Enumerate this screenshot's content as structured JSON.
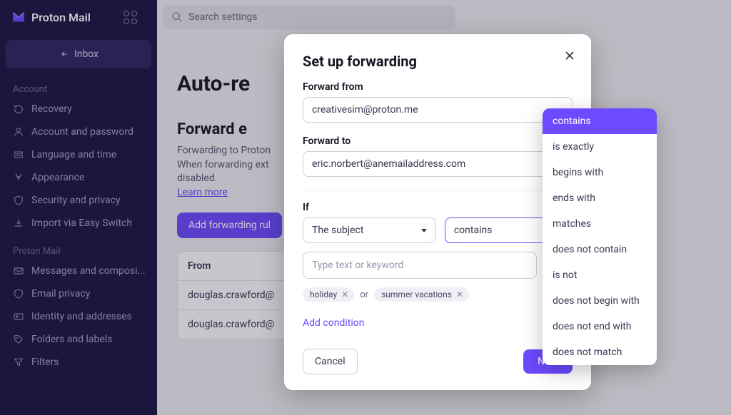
{
  "brand": "Proton Mail",
  "search": {
    "placeholder": "Search settings"
  },
  "inbox_label": "Inbox",
  "sections": {
    "account": {
      "title": "Account",
      "items": [
        "Recovery",
        "Account and password",
        "Language and time",
        "Appearance",
        "Security and privacy",
        "Import via Easy Switch"
      ]
    },
    "proton_mail": {
      "title": "Proton Mail",
      "items": [
        "Messages and composi...",
        "Email privacy",
        "Identity and addresses",
        "Folders and labels",
        "Filters"
      ]
    }
  },
  "page": {
    "h1": "Auto-re",
    "h2": "Forward e",
    "para1": "Forwarding to Proton",
    "para2": "When forwarding ext",
    "para3": "disabled.",
    "learn_more": "Learn more",
    "add_rule_btn": "Add forwarding rul",
    "table": {
      "header": "From",
      "rows": [
        "douglas.crawford@",
        "douglas.crawford@"
      ]
    }
  },
  "modal": {
    "title": "Set up forwarding",
    "from_label": "Forward from",
    "from_value": "creativesim@proton.me",
    "to_label": "Forward to",
    "to_value": "eric.norbert@anemailaddress.com",
    "if_label": "If",
    "subject_select": "The subject",
    "condition_select": "contains",
    "keyword_placeholder": "Type text or keyword",
    "chips": [
      "holiday",
      "summer vacations"
    ],
    "or": "or",
    "add_condition": "Add condition",
    "cancel": "Cancel",
    "next": "Next"
  },
  "dropdown": {
    "items": [
      "contains",
      "is exactly",
      "begins with",
      "ends with",
      "matches",
      "does not contain",
      "is not",
      "does not begin with",
      "does not end with",
      "does not match"
    ],
    "selected_index": 0
  }
}
